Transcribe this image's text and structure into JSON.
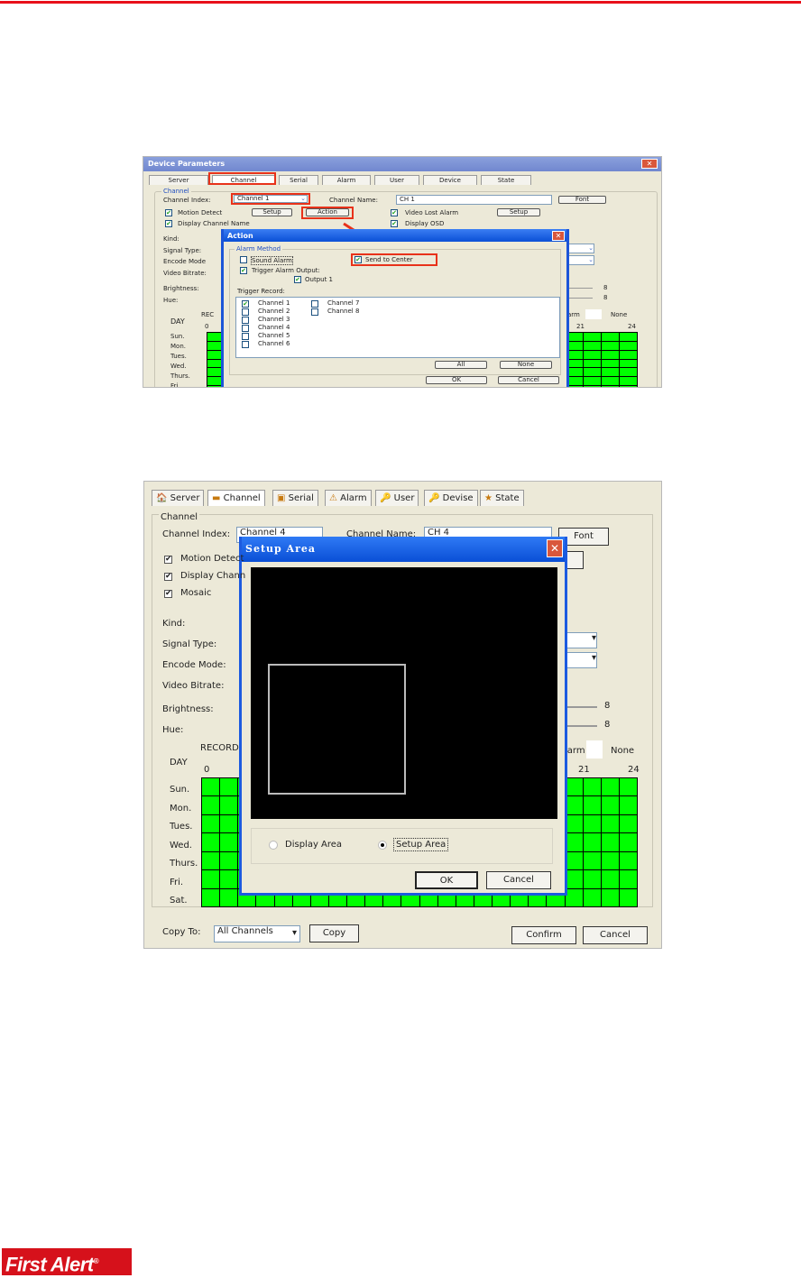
{
  "brand": {
    "logo": "First Alert",
    "reg": "®"
  },
  "shot1": {
    "title": "Device Parameters",
    "tabs": [
      "Server",
      "Channel",
      "Serial",
      "Alarm",
      "User",
      "Device",
      "State"
    ],
    "group": "Channel",
    "channel_index_label": "Channel Index:",
    "channel_index_value": "Channel 1",
    "channel_name_label": "Channel Name:",
    "channel_name_value": "CH 1",
    "font": "Font",
    "motion_detect": "Motion Detect",
    "setup": "Setup",
    "action": "Action",
    "video_lost": "Video Lost Alarm",
    "display_channel_name": "Display Channel Name",
    "display_osd": "Display OSD",
    "labels": [
      "Kind:",
      "Signal Type:",
      "Encode Mode",
      "Video Bitrate:",
      "Brightness:",
      "Hue:"
    ],
    "slider_values": [
      "8",
      "8"
    ],
    "record": "REC",
    "day": "DAY",
    "hour_start": "0",
    "hour_21": "21",
    "hour_24": "24",
    "alarm": "arm",
    "none": "None",
    "days": [
      "Sun.",
      "Mon.",
      "Tues.",
      "Wed.",
      "Thurs.",
      "Fri."
    ],
    "dialog": {
      "title": "Action",
      "close": "✕",
      "alarm_method": "Alarm Method",
      "sound_alarm": "Sound Alarm",
      "send_to_center": "Send to Center",
      "trigger_alarm_output": "Trigger Alarm Output:",
      "output1": "Output 1",
      "trigger_record": "Trigger Record:",
      "channels": [
        {
          "label": "Channel 1",
          "checked": true
        },
        {
          "label": "Channel 2",
          "checked": false
        },
        {
          "label": "Channel 3",
          "checked": false
        },
        {
          "label": "Channel 4",
          "checked": false
        },
        {
          "label": "Channel 5",
          "checked": false
        },
        {
          "label": "Channel 6",
          "checked": false
        },
        {
          "label": "Channel 7",
          "checked": false
        },
        {
          "label": "Channel 8",
          "checked": false
        }
      ],
      "all": "All",
      "none": "None",
      "ok": "OK",
      "cancel": "Cancel"
    }
  },
  "shot2": {
    "tabs": [
      "Server",
      "Channel",
      "Serial",
      "Alarm",
      "User",
      "Devise",
      "State"
    ],
    "group": "Channel",
    "channel_index_label": "Channel Index:",
    "channel_index_value": "Channel 4",
    "channel_name_label": "Channel Name:",
    "channel_name_value": "CH 4",
    "font": "Font",
    "checks": [
      "Motion Detect",
      "Display Chann",
      "Mosaic"
    ],
    "labels": [
      "Kind:",
      "Signal Type:",
      "Encode Mode:",
      "Video Bitrate:",
      "Brightness:",
      "Hue:"
    ],
    "slider_values": [
      "8",
      "8"
    ],
    "record": "RECORD",
    "day": "DAY",
    "hour_start": "0",
    "hour_21": "21",
    "hour_24": "24",
    "alarm": "larm",
    "none": "None",
    "days": [
      "Sun.",
      "Mon.",
      "Tues.",
      "Wed.",
      "Thurs.",
      "Fri.",
      "Sat."
    ],
    "copy_to_label": "Copy To:",
    "copy_to_value": "All Channels",
    "copy": "Copy",
    "confirm": "Confirm",
    "cancel": "Cancel",
    "dialog": {
      "title": "Setup Area",
      "close": "✕",
      "display_area": "Display Area",
      "setup_area": "Setup Area",
      "selected": "Setup Area",
      "ok": "OK",
      "cancel": "Cancel"
    }
  },
  "colors": {
    "grid": "#00ff00",
    "highlight": "#e8321a",
    "brand": "#d6111b"
  }
}
